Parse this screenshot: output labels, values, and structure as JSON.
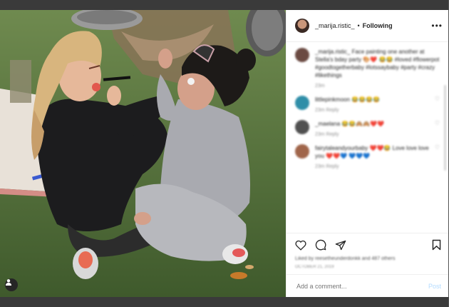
{
  "header": {
    "username": "_marija.ristic_",
    "separator": "•",
    "follow_label": "Following",
    "more_label": "•••"
  },
  "comments": [
    {
      "text": "_marija.ristic_ Face painting one another at Stella's bday party 🎨❤️ 😂😂 #loved #flowerpot #goodtogetherbaby #lotssaybaby #party #crazy #likethings",
      "meta": "23m",
      "avatar_color": "#6b4a42"
    },
    {
      "text": "littlepinkmoon 😂😂😂😂",
      "meta": "23m   Reply",
      "avatar_color": "#2f8ea8"
    },
    {
      "text": "_maelana 😂😂🙈🙈❤️❤️",
      "meta": "23m   Reply",
      "avatar_color": "#505050"
    },
    {
      "text": "fairytaleandyourbaby ❤️❤️😂 Love love love you ❤️❤️💙 💙💙💙",
      "meta": "23m   Reply",
      "avatar_color": "#a0654a"
    }
  ],
  "likes_text": "Liked by reesetheunderdonkk and 487 others",
  "timestamp_text": "OCTOBER 21, 2019",
  "add_comment": {
    "placeholder": "Add a comment...",
    "post_label": "Post"
  },
  "colors": {
    "post_button": "#b3dbff",
    "background": "#3a3a3a"
  }
}
